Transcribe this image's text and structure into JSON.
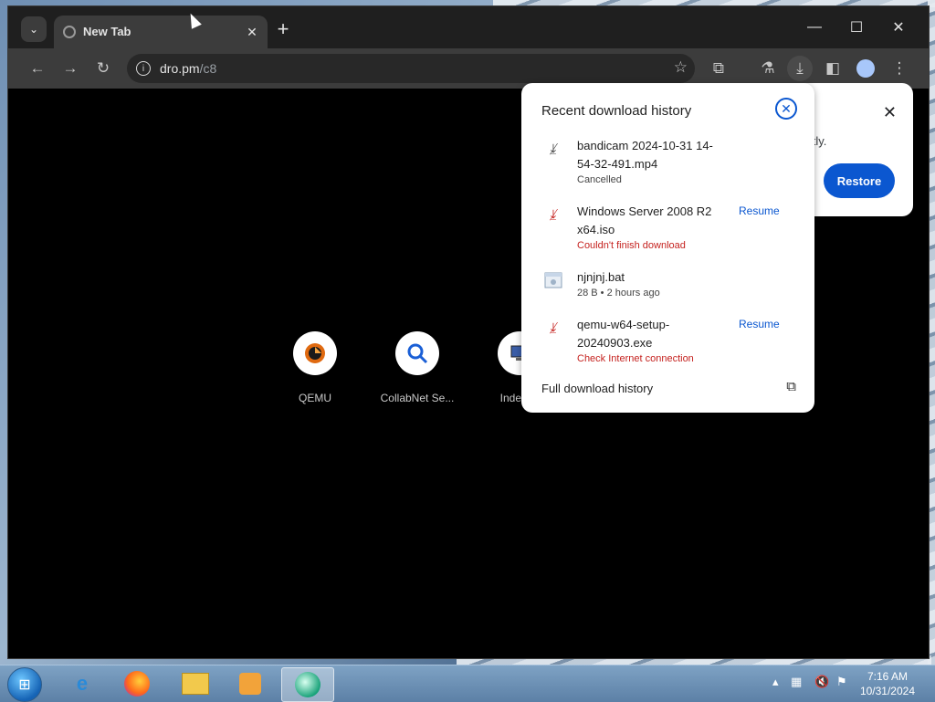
{
  "window": {
    "tab_title": "New Tab",
    "new_tab_symbol": "+",
    "controls": {
      "minimize": "—",
      "maximize": "☐",
      "close": "✕"
    }
  },
  "toolbar": {
    "url_host": "dro.pm",
    "url_path": "/c8"
  },
  "shortcuts": [
    {
      "label": "QEMU",
      "icon": "qemu-icon"
    },
    {
      "label": "CollabNet Se...",
      "icon": "magnifier-icon"
    },
    {
      "label": "Index of",
      "icon": "computer-icon"
    }
  ],
  "restore_bubble": {
    "text": "ectly.",
    "button": "Restore"
  },
  "downloads": {
    "title": "Recent download history",
    "items": [
      {
        "name": "bandicam 2024-10-31 14-54-32-491.mp4",
        "status": "Cancelled",
        "status_type": "normal",
        "action": ""
      },
      {
        "name": "Windows Server 2008 R2 x64.iso",
        "status": "Couldn't finish download",
        "status_type": "error",
        "action": "Resume"
      },
      {
        "name": "njnjnj.bat",
        "status": "28 B • 2 hours ago",
        "status_type": "normal",
        "action": ""
      },
      {
        "name": "qemu-w64-setup-20240903.exe",
        "status": "Check Internet connection",
        "status_type": "error",
        "action": "Resume"
      }
    ],
    "full_history": "Full download history"
  },
  "taskbar": {
    "time": "7:16 AM",
    "date": "10/31/2024"
  },
  "colors": {
    "accent": "#0b57d0",
    "error": "#c5221f"
  }
}
